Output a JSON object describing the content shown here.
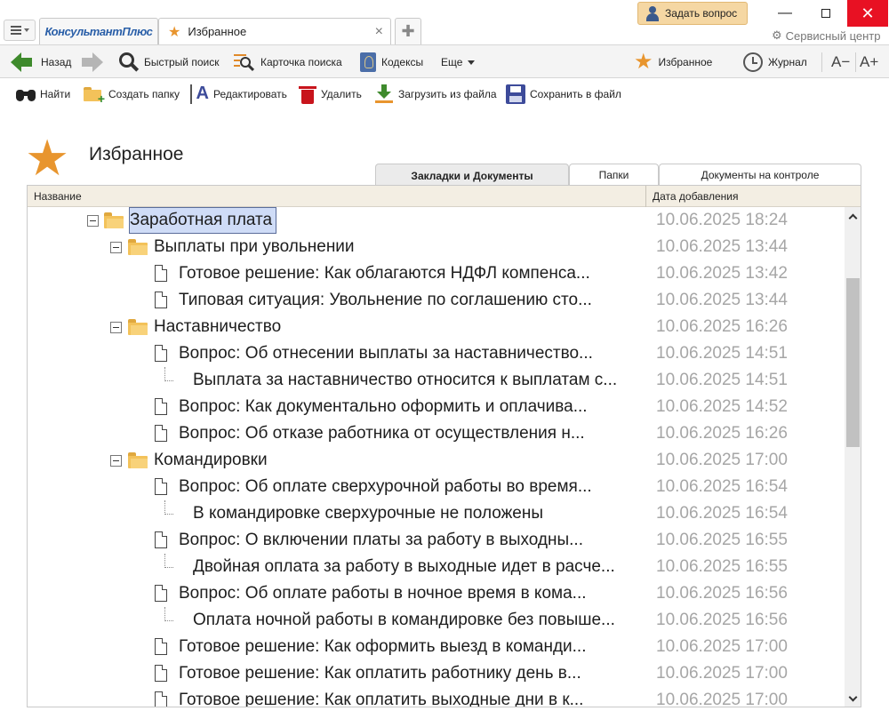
{
  "app": {
    "logo": "КонсультантПлюс",
    "tab_title": "Избранное",
    "ask_question": "Задать вопрос",
    "service_center": "Сервисный центр"
  },
  "nav": {
    "back": "Назад",
    "quick_search": "Быстрый поиск",
    "search_card": "Карточка поиска",
    "codes": "Кодексы",
    "more": "Еще",
    "favorites": "Избранное",
    "journal": "Журнал",
    "font_smaller": "A−",
    "font_larger": "A+"
  },
  "actions": {
    "find": "Найти",
    "create_folder": "Создать папку",
    "edit": "Редактировать",
    "delete": "Удалить",
    "load_from_file": "Загрузить из файла",
    "save_to_file": "Сохранить в файл"
  },
  "page": {
    "title": "Избранное"
  },
  "tabs": [
    {
      "label": "Закладки и Документы",
      "active": true
    },
    {
      "label": "Папки",
      "active": false
    },
    {
      "label": "Документы на контроле",
      "active": false
    }
  ],
  "table": {
    "col_name": "Название",
    "col_date": "Дата добавления",
    "rows": [
      {
        "type": "folder",
        "level": 0,
        "label": "Заработная плата",
        "date": "10.06.2025 18:24",
        "selected": true
      },
      {
        "type": "folder",
        "level": 1,
        "label": "Выплаты при увольнении",
        "date": "10.06.2025 13:44"
      },
      {
        "type": "doc",
        "level": 2,
        "label": "Готовое решение: Как облагаются НДФЛ компенса...",
        "date": "10.06.2025 13:42"
      },
      {
        "type": "doc",
        "level": 2,
        "label": "Типовая ситуация: Увольнение по соглашению сто...",
        "date": "10.06.2025 13:44"
      },
      {
        "type": "folder",
        "level": 1,
        "label": "Наставничество",
        "date": "10.06.2025 16:26"
      },
      {
        "type": "doc",
        "level": 2,
        "label": "Вопрос: Об отнесении выплаты за наставничество...",
        "date": "10.06.2025 14:51"
      },
      {
        "type": "bookmark",
        "level": 3,
        "label": "Выплата за наставничество относится к выплатам с...",
        "date": "10.06.2025 14:51"
      },
      {
        "type": "doc",
        "level": 2,
        "label": "Вопрос: Как документально оформить и оплачива...",
        "date": "10.06.2025 14:52"
      },
      {
        "type": "doc",
        "level": 2,
        "label": "Вопрос: Об отказе работника от осуществления н...",
        "date": "10.06.2025 16:26"
      },
      {
        "type": "folder",
        "level": 1,
        "label": "Командировки",
        "date": "10.06.2025 17:00"
      },
      {
        "type": "doc",
        "level": 2,
        "label": "Вопрос: Об оплате сверхурочной работы во время...",
        "date": "10.06.2025 16:54"
      },
      {
        "type": "bookmark",
        "level": 3,
        "label": "В командировке сверхурочные не положены",
        "date": "10.06.2025 16:54"
      },
      {
        "type": "doc",
        "level": 2,
        "label": "Вопрос: О включении платы за работу в выходны...",
        "date": "10.06.2025 16:55"
      },
      {
        "type": "bookmark",
        "level": 3,
        "label": "Двойная оплата за работу в выходные идет в расче...",
        "date": "10.06.2025 16:55"
      },
      {
        "type": "doc",
        "level": 2,
        "label": "Вопрос: Об оплате работы в ночное время в кома...",
        "date": "10.06.2025 16:56"
      },
      {
        "type": "bookmark",
        "level": 3,
        "label": "Оплата ночной работы в командировке без повыше...",
        "date": "10.06.2025 16:56"
      },
      {
        "type": "doc",
        "level": 2,
        "label": "Готовое решение: Как оформить выезд в команди...",
        "date": "10.06.2025 17:00"
      },
      {
        "type": "doc",
        "level": 2,
        "label": "Готовое решение: Как оплатить работнику день в...",
        "date": "10.06.2025 17:00"
      },
      {
        "type": "doc",
        "level": 2,
        "label": "Готовое решение: Как оплатить выходные дни в к...",
        "date": "10.06.2025 17:00"
      }
    ]
  },
  "colors": {
    "accent_star": "#e8952e",
    "selection": "#cfdcf7",
    "close_red": "#e81123",
    "date_gray": "#a6a6a6"
  }
}
